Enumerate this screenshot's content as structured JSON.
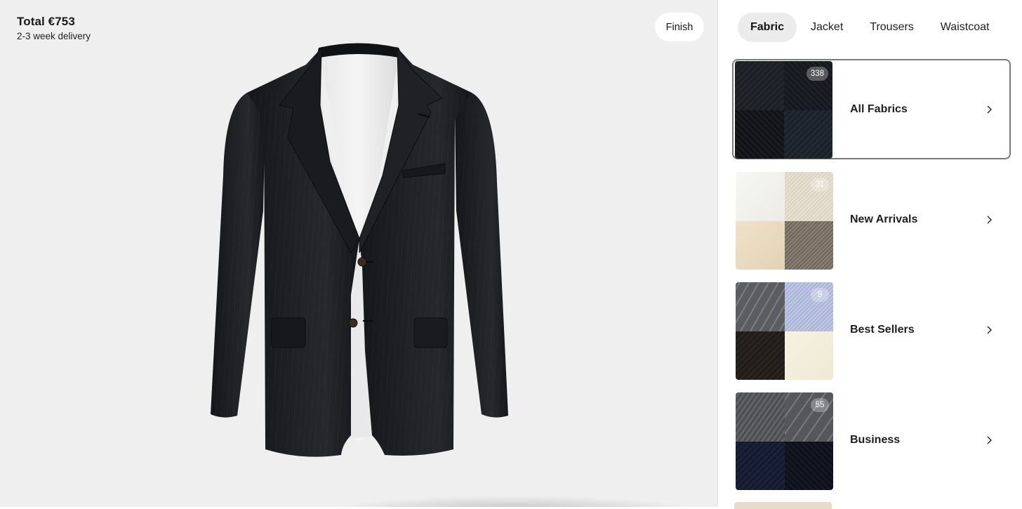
{
  "summary": {
    "total": "Total €753",
    "delivery": "2-3 week delivery"
  },
  "actions": {
    "finish_label": "Finish"
  },
  "tabs": [
    {
      "label": "Fabric",
      "active": true
    },
    {
      "label": "Jacket",
      "active": false
    },
    {
      "label": "Trousers",
      "active": false
    },
    {
      "label": "Waistcoat",
      "active": false
    }
  ],
  "categories": [
    {
      "label": "All Fabrics",
      "count": "338",
      "selected": true
    },
    {
      "label": "New Arrivals",
      "count": "31",
      "selected": false
    },
    {
      "label": "Best Sellers",
      "count": "9",
      "selected": false
    },
    {
      "label": "Business",
      "count": "55",
      "selected": false
    }
  ],
  "icons": {
    "category_arrow": "chevron-right-icon"
  },
  "colors": {
    "preview_bg": "#efefef",
    "active_tab_bg": "#ebebeb",
    "selected_border": "#7a7a7a",
    "jacket": "#1b1c1f"
  }
}
